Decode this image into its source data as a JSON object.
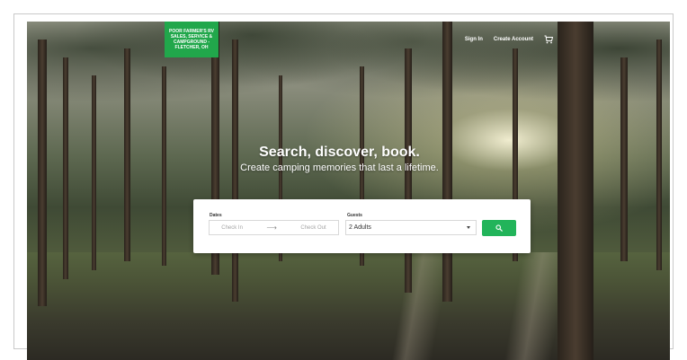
{
  "brand": {
    "logo_text": "POOR FARMER'S RV SALES, SERVICE & CAMPGROUND - FLETCHER, OH",
    "accent_color": "#21a74b"
  },
  "nav": {
    "sign_in": "Sign In",
    "create_account": "Create Account",
    "cart_icon": "shopping-cart-icon"
  },
  "hero": {
    "headline": "Search, discover, book.",
    "subheadline": "Create camping memories that last a lifetime."
  },
  "search": {
    "dates_label": "Dates",
    "check_in_placeholder": "Check In",
    "check_out_placeholder": "Check Out",
    "arrow_icon": "arrow-right-icon",
    "guests_label": "Guests",
    "guests_value": "2 Adults",
    "search_icon": "search-icon",
    "button_color": "#22b45a"
  }
}
